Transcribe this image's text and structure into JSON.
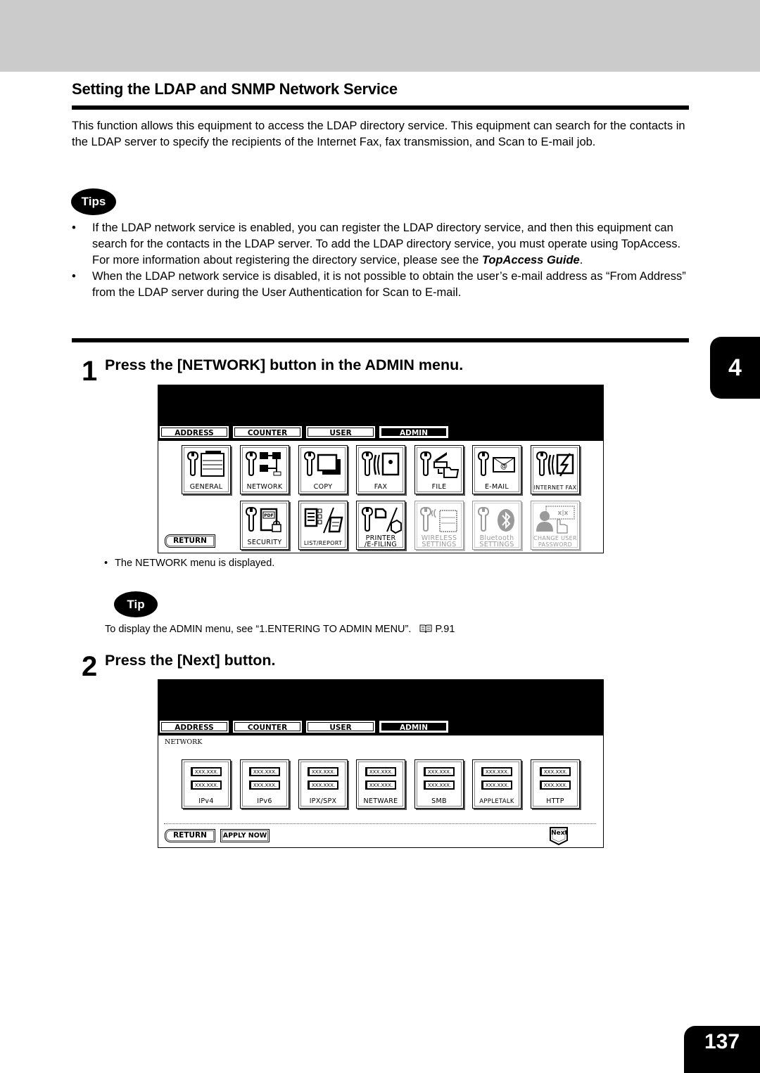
{
  "section": {
    "title": "Setting the LDAP and SNMP Network Service",
    "intro": "This function allows this equipment to access the LDAP directory service.  This equipment can search for the contacts in the LDAP server to specify the recipients of the Internet Fax, fax transmission, and Scan to E-mail job."
  },
  "tips": {
    "badge": "Tips",
    "items": [
      {
        "bullet": "•",
        "text_before": "If the LDAP network service is enabled, you can register the LDAP directory service, and then this equipment can search for the contacts in the LDAP server.  To add the LDAP directory service, you must operate using TopAccess.  For more information about registering the directory service, please see the ",
        "emphasis": "TopAccess Guide",
        "text_after": "."
      },
      {
        "bullet": "•",
        "text": "When the LDAP network service is disabled, it is not possible to obtain the user’s e-mail address as “From Address” from the LDAP server during the User Authentication for Scan to E-mail."
      }
    ]
  },
  "step1": {
    "number": "1",
    "text": "Press the [NETWORK] button in the ADMIN menu.",
    "result_bullet": "•",
    "result": "The NETWORK menu is displayed.",
    "panel": {
      "tabs": [
        {
          "label": "ADDRESS",
          "active": false
        },
        {
          "label": "COUNTER",
          "active": false
        },
        {
          "label": "USER",
          "active": false
        },
        {
          "label": "ADMIN",
          "active": true
        }
      ],
      "row1": [
        {
          "label": "GENERAL",
          "icon": "copier-icon"
        },
        {
          "label": "NETWORK",
          "icon": "network-icon"
        },
        {
          "label": "COPY",
          "icon": "copy-icon"
        },
        {
          "label": "FAX",
          "icon": "fax-icon"
        },
        {
          "label": "FILE",
          "icon": "file-folder-icon"
        },
        {
          "label": "E-MAIL",
          "icon": "email-icon"
        },
        {
          "label": "INTERNET FAX",
          "icon": "internet-fax-icon"
        }
      ],
      "row2": [
        {
          "label": "SECURITY",
          "label2": "",
          "icon": "pdf-lock-icon",
          "enabled": true
        },
        {
          "label": "LIST/REPORT",
          "label2": "",
          "icon": "list-report-icon",
          "enabled": true
        },
        {
          "label": "PRINTER",
          "label2": "/E-FILING",
          "icon": "printer-icon",
          "enabled": true
        },
        {
          "label": "WIRELESS",
          "label2": "SETTINGS",
          "icon": "wireless-icon",
          "enabled": false
        },
        {
          "label": "Bluetooth",
          "label2": "SETTINGS",
          "icon": "bluetooth-icon",
          "enabled": false
        },
        {
          "label": "CHANGE USER",
          "label2": "PASSWORD",
          "icon": "user-password-icon",
          "enabled": false
        }
      ],
      "return_label": "RETURN"
    }
  },
  "tip": {
    "badge": "Tip",
    "text": "To display the ADMIN menu, see “1.ENTERING TO ADMIN MENU”.",
    "ref_icon": "book-icon",
    "ref": "P.91"
  },
  "step2": {
    "number": "2",
    "text": "Press the [Next] button.",
    "panel": {
      "tabs": [
        {
          "label": "ADDRESS",
          "active": false
        },
        {
          "label": "COUNTER",
          "active": false
        },
        {
          "label": "USER",
          "active": false
        },
        {
          "label": "ADMIN",
          "active": true
        }
      ],
      "breadcrumb": "NETWORK",
      "placeholder_value": "XXX.XXX.",
      "buttons": [
        "IPv4",
        "IPv6",
        "IPX/SPX",
        "NETWARE",
        "SMB",
        "APPLETALK",
        "HTTP"
      ],
      "return_label": "RETURN",
      "apply_label": "APPLY NOW",
      "next_label": "Next"
    }
  },
  "chapter_tab": "4",
  "page_number": "137"
}
